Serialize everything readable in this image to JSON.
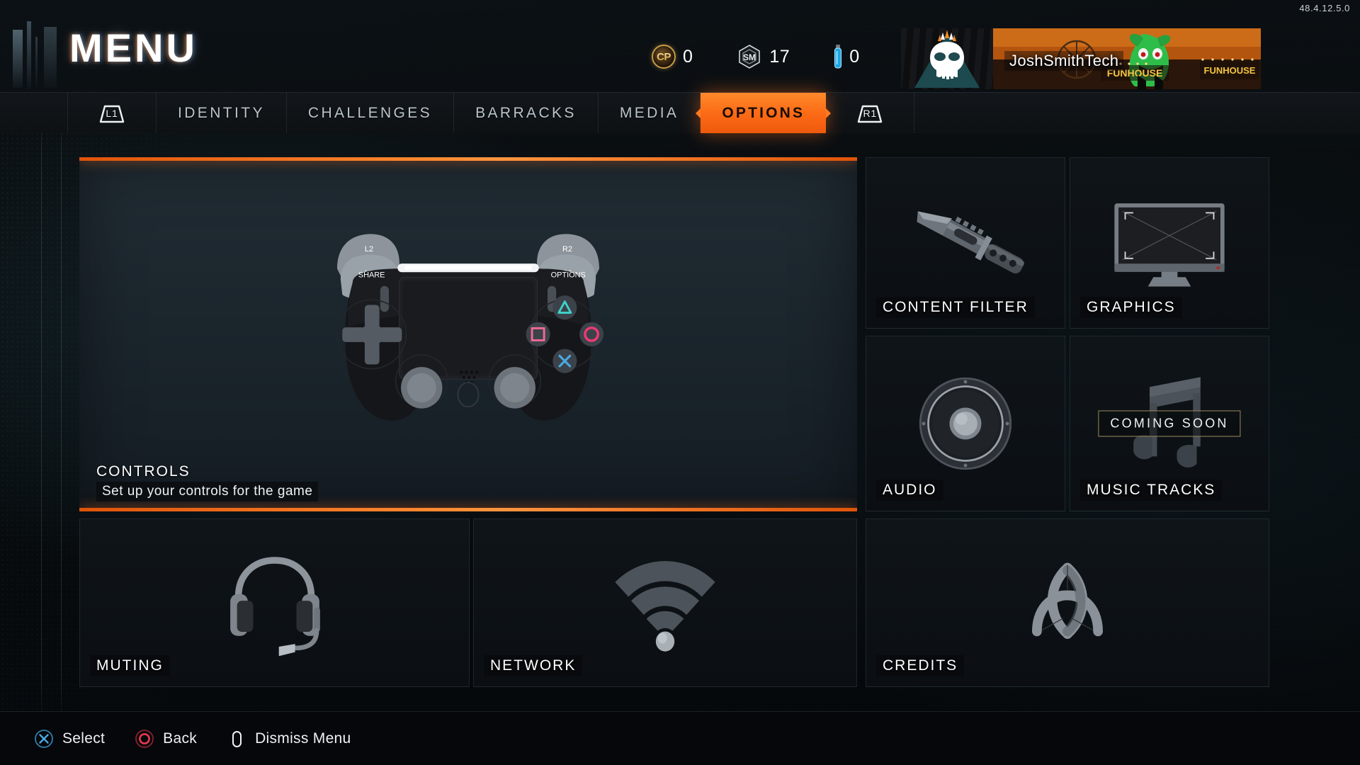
{
  "version": "48.4.12.5.0",
  "header": {
    "title": "MENU",
    "currencies": [
      {
        "icon": "cp-coin-icon",
        "name": "CP",
        "label": "CP",
        "value": "0"
      },
      {
        "icon": "salvage-cube-icon",
        "name": "Salvage",
        "label": "SM",
        "value": "17"
      },
      {
        "icon": "cryptokey-icon",
        "name": "Cryptokeys",
        "label": "",
        "value": "0"
      }
    ],
    "player": {
      "gamertag": "JoshSmithTech",
      "emblem": "skull-crown-emblem",
      "calling_card": "funhouse-carnival-banner"
    }
  },
  "nav": {
    "left_bumper": "L1",
    "right_bumper": "R1",
    "tabs": [
      {
        "label": "IDENTITY",
        "active": false
      },
      {
        "label": "CHALLENGES",
        "active": false
      },
      {
        "label": "BARRACKS",
        "active": false
      },
      {
        "label": "MEDIA",
        "active": false
      },
      {
        "label": "OPTIONS",
        "active": true
      }
    ]
  },
  "options": {
    "selected": {
      "title": "CONTROLS",
      "description": "Set up your controls for the game",
      "icon": "ps4-controller-icon",
      "controller": {
        "left_trigger": "L2",
        "left_bumper": "L1",
        "right_trigger": "R2",
        "right_bumper": "R1",
        "share_label": "SHARE",
        "options_label": "OPTIONS"
      }
    },
    "cards": [
      {
        "title": "CONTENT FILTER",
        "icon": "combat-knife-icon",
        "badge": ""
      },
      {
        "title": "GRAPHICS",
        "icon": "monitor-icon",
        "badge": ""
      },
      {
        "title": "AUDIO",
        "icon": "speaker-cone-icon",
        "badge": ""
      },
      {
        "title": "MUSIC TRACKS",
        "icon": "music-note-icon",
        "badge": "COMING SOON"
      },
      {
        "title": "MUTING",
        "icon": "headset-icon",
        "badge": ""
      },
      {
        "title": "NETWORK",
        "icon": "wifi-icon",
        "badge": ""
      },
      {
        "title": "CREDITS",
        "icon": "treyarch-logo-icon",
        "badge": ""
      }
    ]
  },
  "footer": {
    "actions": [
      {
        "icon": "playstation-cross-icon",
        "label": "Select"
      },
      {
        "icon": "playstation-circle-icon",
        "label": "Back"
      },
      {
        "icon": "playstation-options-icon",
        "label": "Dismiss Menu"
      }
    ]
  },
  "colors": {
    "accent_orange": "#ff7a1e",
    "accent_orange_dark": "#e0540a",
    "panel_selected": "#212c34",
    "panel_dark": "#0f1418",
    "cross_blue": "#4aa8e0",
    "circle_red": "#e8394f",
    "triangle_teal": "#3fd0c9",
    "square_pink": "#ef6a96"
  }
}
